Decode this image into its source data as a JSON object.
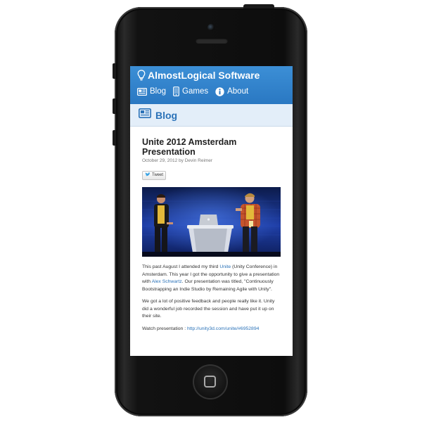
{
  "site": {
    "title": "AlmostLogical Software",
    "brand_color": "#2a7cc7"
  },
  "nav": [
    {
      "label": "Blog",
      "icon": "newspaper-icon"
    },
    {
      "label": "Games",
      "icon": "phone-icon"
    },
    {
      "label": "About",
      "icon": "info-icon"
    }
  ],
  "section": {
    "title": "Blog",
    "icon": "newspaper-icon"
  },
  "post": {
    "title": "Unite 2012 Amsterdam Presentation",
    "meta": "October 29, 2012 by Devin Reimer",
    "tweet_label": "Tweet",
    "p1_before": "This past August I attended my third ",
    "p1_link1": "Unite",
    "p1_mid": " (Unity Conference) in Amsterdam. This year I got the opportunity to give a presentation with ",
    "p1_link2": "Alex Schwartz",
    "p1_after": ". Our presentation was titled, \"Continuously Bootstrapping an Indie Studio by Remaining Agile with Unity\".",
    "p2": "We got a lot of positive feedback and people really like it. Unity did a wonderful job recorded the session and have put it up on their site.",
    "p3_label": "Watch presentation : ",
    "p3_link": "http://unity3d.com/unite/#6952894"
  }
}
